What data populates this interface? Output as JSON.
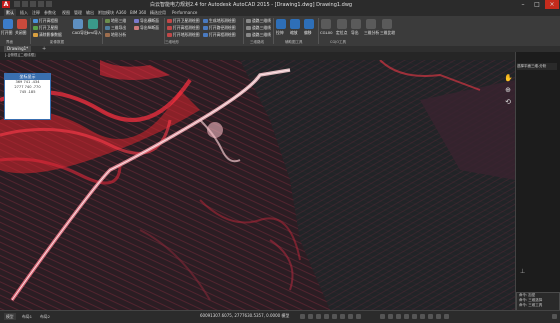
{
  "app": {
    "title": "白云智能电力规划2.4 for Autodesk AutoCAD 2015 - [Drawing1.dwg]    Drawing1.dwg",
    "logo_text": "A"
  },
  "menu_tabs": [
    "默认",
    "插入",
    "注释",
    "参数化",
    "视图",
    "管理",
    "输出",
    "附加模块",
    "A360",
    "BIM 360",
    "精选应用",
    "Performance"
  ],
  "ribbon": {
    "col1": [
      "打开图",
      "关闭图"
    ],
    "col2": [
      "打开高程图",
      "打开卫星图",
      "清除影像数据"
    ],
    "col3": [
      "CAD导出",
      "kml导入"
    ],
    "col4": [
      "地形三维",
      "三维导出",
      "地形分析"
    ],
    "col5": [
      "导出横断面",
      "导出纵断面"
    ],
    "col6": [
      "打开卫星测绘图",
      "打开高程测绘图",
      "打开地形测绘图"
    ],
    "col7": [
      "生成地形测绘图",
      "打开路径测绘图",
      "打开高程测绘图"
    ],
    "col8": [
      "道路三维线",
      "道路三维线",
      "道路三维线"
    ],
    "col9": [
      "拉伸",
      "缩放",
      "偏移"
    ],
    "col10": [
      "CGL00",
      "定位点",
      "导出"
    ],
    "col11": [
      "三维分析",
      "三维比较",
      "三维路线"
    ],
    "groups": [
      "界面",
      "影像数据",
      "三维地形",
      "三维地形",
      "三维路线",
      "辅助图工具",
      "CGJO工具"
    ]
  },
  "file_tabs": [
    "Drawing1*"
  ],
  "view_label": "[-][俯视][二维线框]",
  "coord_box": {
    "title": "坐标显示",
    "rows": [
      "369 741 .434",
      "2777 740 .770",
      "745 .185"
    ]
  },
  "right_panel": {
    "title": "选择平面三维-分析",
    "cmd_lines": [
      "命令: 加密",
      "命令: 三维选择",
      "命令: 三维工具"
    ]
  },
  "status": {
    "coords": "60091307.6075, 2777630.5357, 0.0000  模型",
    "model_tab": "模型",
    "layout_tabs": [
      "布局1",
      "布局2"
    ]
  },
  "nav_icons": [
    "pan-icon",
    "zoom-icon",
    "orbit-icon"
  ]
}
